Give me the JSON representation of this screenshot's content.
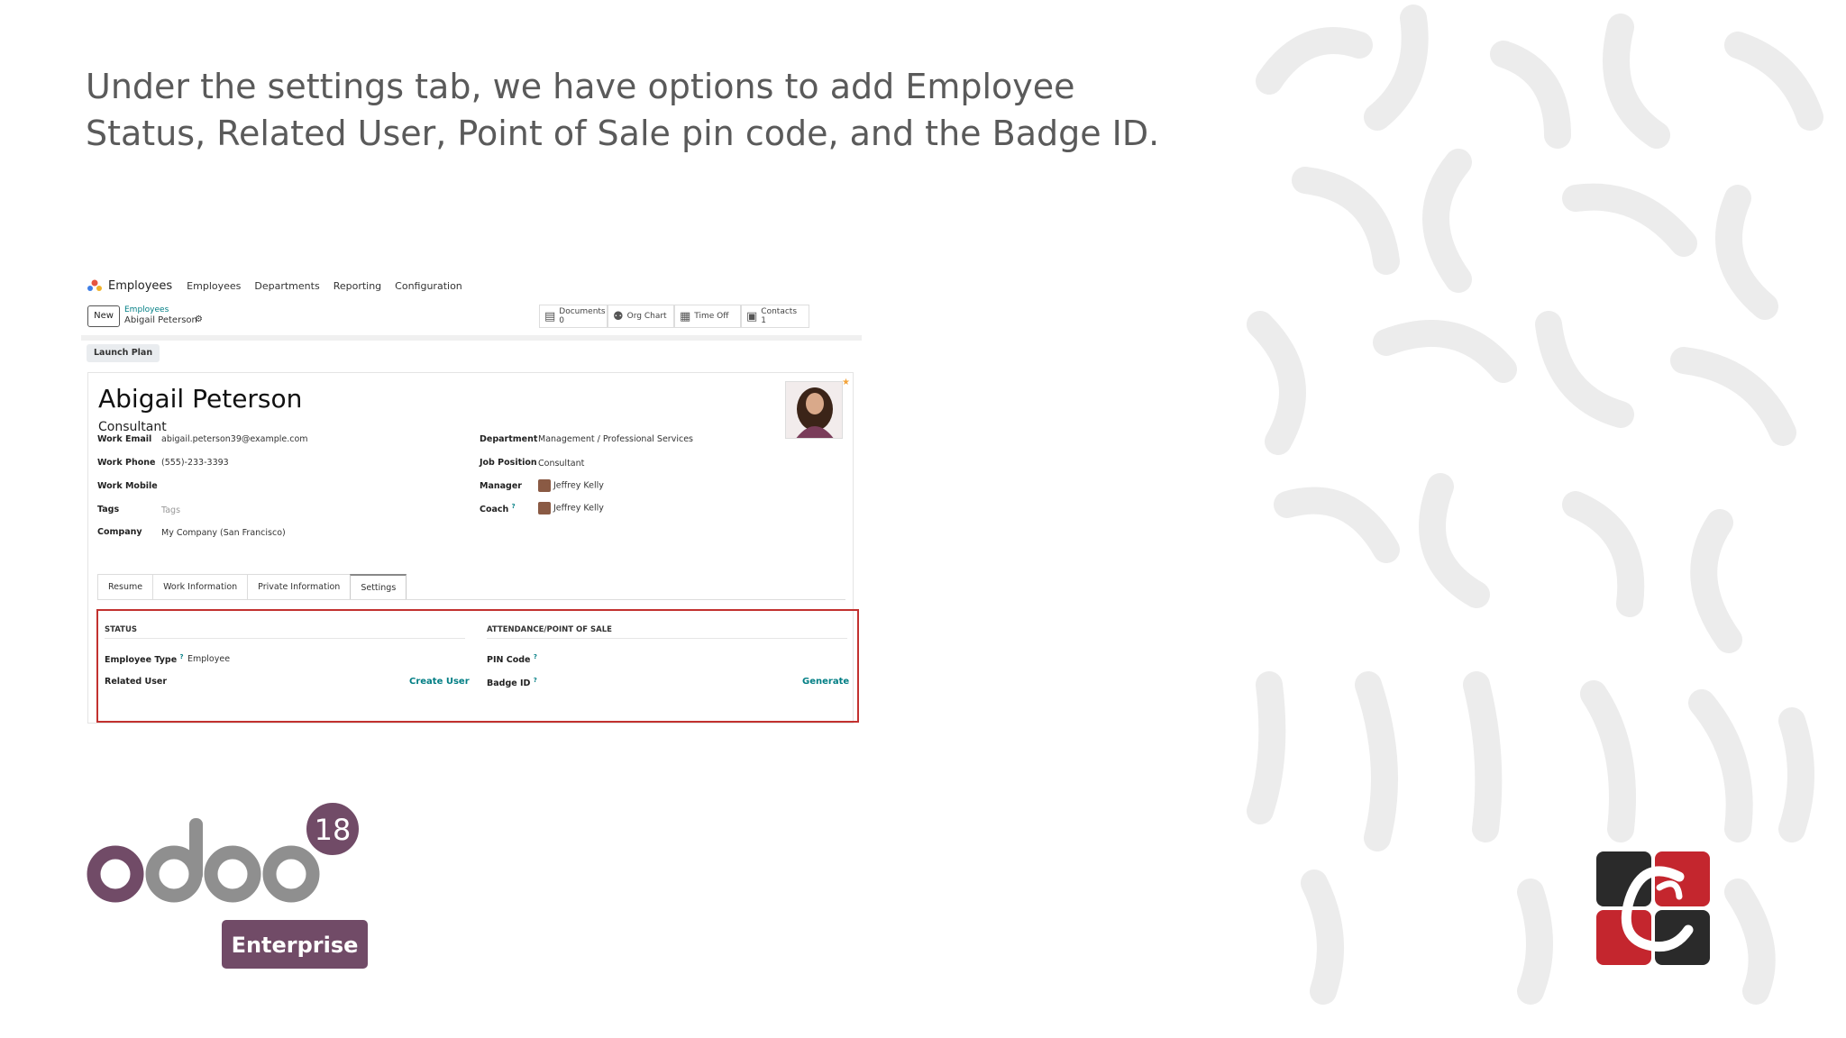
{
  "caption": {
    "line1": "Under the settings tab, we have options to  add Employee",
    "line2": "Status, Related User, Point of Sale pin code, and the  Badge ID."
  },
  "navbar": {
    "brand": "Employees",
    "items": [
      "Employees",
      "Departments",
      "Reporting",
      "Configuration"
    ]
  },
  "control": {
    "new_label": "New",
    "breadcrumb_parent": "Employees",
    "breadcrumb_current": "Abigail Peterson",
    "smart_buttons": [
      {
        "icon": "document-icon",
        "label": "Documents",
        "count": "0"
      },
      {
        "icon": "org-chart-icon",
        "label": "Org Chart",
        "count": ""
      },
      {
        "icon": "calendar-icon",
        "label": "Time Off",
        "count": ""
      },
      {
        "icon": "contact-card-icon",
        "label": "Contacts",
        "count": "1"
      }
    ]
  },
  "launch_plan": "Launch Plan",
  "employee": {
    "name": "Abigail Peterson",
    "job_title": "Consultant",
    "left_fields": {
      "work_email_label": "Work Email",
      "work_email": "abigail.peterson39@example.com",
      "work_phone_label": "Work Phone",
      "work_phone": "(555)-233-3393",
      "work_mobile_label": "Work Mobile",
      "tags_label": "Tags",
      "tags_placeholder": "Tags",
      "company_label": "Company",
      "company": "My Company (San Francisco)"
    },
    "right_fields": {
      "department_label": "Department",
      "department": "Management / Professional Services",
      "job_position_label": "Job Position",
      "job_position": "Consultant",
      "manager_label": "Manager",
      "manager": "Jeffrey Kelly",
      "coach_label": "Coach",
      "coach": "Jeffrey Kelly"
    }
  },
  "tabs": [
    "Resume",
    "Work Information",
    "Private Information",
    "Settings"
  ],
  "active_tab": "Settings",
  "settings": {
    "status_title": "STATUS",
    "employee_type_label": "Employee Type",
    "employee_type": "Employee",
    "related_user_label": "Related User",
    "create_user": "Create User",
    "pos_title": "ATTENDANCE/POINT OF SALE",
    "pin_code_label": "PIN Code",
    "badge_id_label": "Badge ID",
    "generate": "Generate",
    "help_mark": "?"
  },
  "branding": {
    "odoo_version": "18",
    "odoo_edition": "Enterprise",
    "odoo_color": "#714b67",
    "accent_link_color": "#017e84",
    "highlight_color": "#c2312f"
  }
}
